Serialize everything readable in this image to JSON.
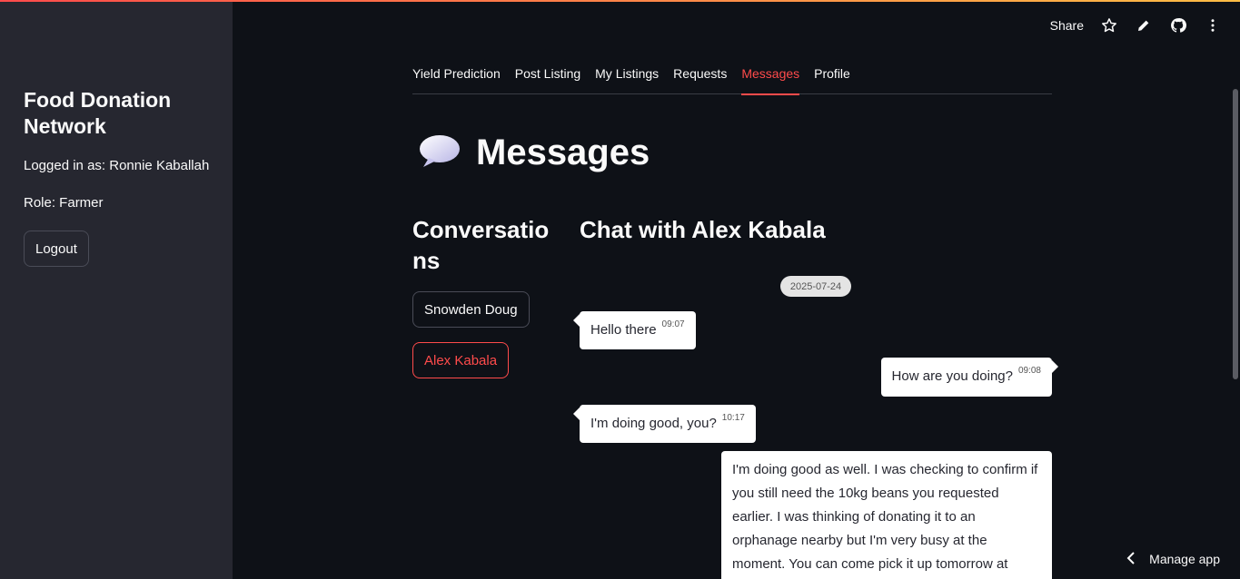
{
  "sidebar": {
    "app_title": "Food Donation Network",
    "logged_in": "Logged in as: Ronnie Kaballah",
    "role": "Role: Farmer",
    "logout_label": "Logout"
  },
  "toolbar": {
    "share_label": "Share",
    "icons": [
      "star-icon",
      "pencil-icon",
      "github-icon",
      "more-vert-icon"
    ]
  },
  "tabs": [
    {
      "label": "Yield Prediction",
      "active": false
    },
    {
      "label": "Post Listing",
      "active": false
    },
    {
      "label": "My Listings",
      "active": false
    },
    {
      "label": "Requests",
      "active": false
    },
    {
      "label": "Messages",
      "active": true
    },
    {
      "label": "Profile",
      "active": false
    }
  ],
  "page": {
    "icon": "speech-bubble-icon",
    "title": "Messages"
  },
  "conversations": {
    "heading": "Conversations",
    "items": [
      {
        "label": "Snowden Doug",
        "active": false
      },
      {
        "label": "Alex Kabala",
        "active": true
      }
    ]
  },
  "chat": {
    "heading": "Chat with Alex Kabala",
    "date": "2025-07-24",
    "messages": [
      {
        "side": "left",
        "text": "Hello there",
        "time": "09:07"
      },
      {
        "side": "right",
        "text": "How are you doing?",
        "time": "09:08"
      },
      {
        "side": "left",
        "text": "I'm doing good, you?",
        "time": "10:17"
      },
      {
        "side": "right",
        "text": "I'm doing good as well. I was checking to confirm if you still need the 10kg beans you requested earlier. I was thinking of donating it to an orphanage nearby but I'm very busy at the moment. You can come pick it up tomorrow at",
        "time": ""
      }
    ]
  },
  "footer": {
    "manage_label": "Manage app"
  },
  "colors": {
    "accent": "#ff4b4b",
    "background": "#0e1117",
    "sidebar": "#262730"
  }
}
